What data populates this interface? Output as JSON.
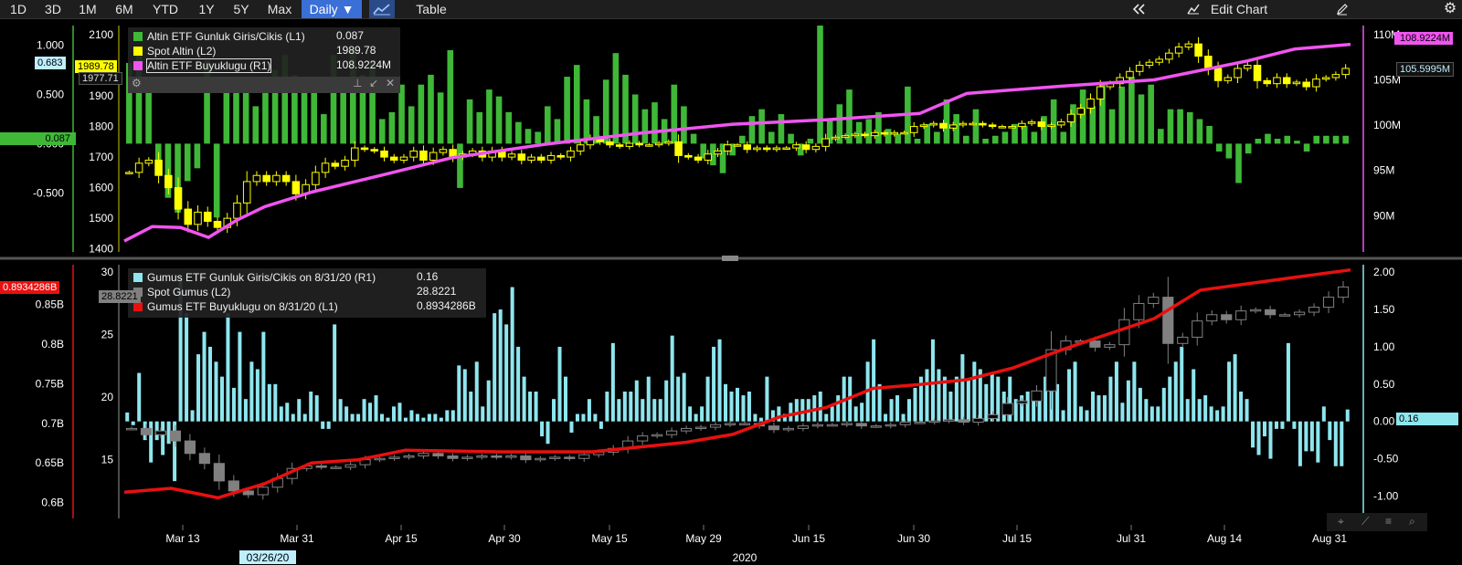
{
  "toolbar": {
    "ranges": [
      "1D",
      "3D",
      "1M",
      "6M",
      "YTD",
      "1Y",
      "5Y",
      "Max"
    ],
    "frequency": "Daily ▼",
    "table_label": "Table",
    "edit_label": "Edit Chart",
    "collapse_icon": "double-chevron-left-icon",
    "chart_icon": "line-chart-icon",
    "edit_icon": "chart-edit-icon",
    "pencil_icon": "pencil-icon",
    "gear_icon": "gear-icon"
  },
  "upper_legend": {
    "rows": [
      {
        "label": "Altin ETF Gunluk Giris/Cikis (L1)",
        "value": "0.087",
        "color": "#3fb837"
      },
      {
        "label": "Spot Altin (L2)",
        "value": "1989.78",
        "color": "#ffff00"
      },
      {
        "label": "Altin ETF Buyuklugu (R1)",
        "value": "108.9224M",
        "color": "#f055f0"
      }
    ],
    "tools": {
      "gear": "gear-icon",
      "pin": "pin-icon",
      "expand": "expand-icon",
      "close": "close-icon"
    }
  },
  "lower_legend": {
    "rows": [
      {
        "label": "Gumus ETF Gunluk Giris/Cikis on 8/31/20 (R1)",
        "value": "0.16",
        "color": "#8ee6ee"
      },
      {
        "label": "Spot Gumus (L2)",
        "value": "28.8221",
        "color": "#808080"
      },
      {
        "label": "Gumus ETF Buyuklugu on 8/31/20 (L1)",
        "value": "0.8934286B",
        "color": "#e81010"
      }
    ]
  },
  "tags": {
    "upper_L1_last": "0.087",
    "upper_L2_last": "1989.78",
    "upper_L2_prev": "1977.71",
    "upper_L1_cursor": "0.683",
    "upper_R1_last": "108.9224M",
    "upper_R1_alt": "105.5995M",
    "lower_L1_last": "0.8934286B",
    "lower_L2_last": "28.8221",
    "lower_R1_last": "0.16"
  },
  "bottom_tools": [
    "crosshair-icon",
    "draw-line-icon",
    "menu-icon",
    "zoom-icon"
  ],
  "chart_data": [
    {
      "type": "bar",
      "title": "",
      "axes": {
        "L1": {
          "ticks": [
            "1.000",
            "0.500",
            "0.000",
            "-0.500"
          ],
          "range": [
            -1.1,
            1.2
          ]
        },
        "L2": {
          "ticks": [
            "2100",
            "2000",
            "1900",
            "1800",
            "1700",
            "1600",
            "1500",
            "1400"
          ],
          "range": [
            1390,
            2130
          ]
        },
        "R1": {
          "ticks": [
            "110M",
            "105M",
            "100M",
            "95M",
            "90M"
          ],
          "range": [
            86,
            111
          ]
        }
      },
      "x_labels": [
        "Mar 13",
        "Mar 31",
        "Apr 15",
        "Apr 30",
        "May 15",
        "May 29",
        "Jun 15",
        "Jun 30",
        "Jul 15",
        "Jul 31",
        "Aug 14",
        "Aug 31"
      ],
      "series": [
        {
          "name": "Altin ETF Gunluk Giris/Cikis (L1)",
          "type": "bar",
          "axis": "L1",
          "color": "#3fb837",
          "values": [
            0.82,
            0.9,
            0.62,
            -0.2,
            -0.55,
            -0.7,
            -0.38,
            -0.25,
            0.85,
            -0.75,
            0.68,
            0.65,
            0.52,
            0.38,
            0.65,
            0.75,
            0.9,
            0.7,
            0.65,
            0.55,
            0.3,
            0.9,
            0.65,
            0.95,
            0.7,
            0.85,
            0.25,
            0.32,
            0.6,
            0.38,
            0.6,
            0.7,
            0.52,
            0.95,
            -0.45,
            0.45,
            0.32,
            0.55,
            0.48,
            0.32,
            0.22,
            0.15,
            0.12,
            0.38,
            0.25,
            0.68,
            0.8,
            0.45,
            0.28,
            0.65,
            0.92,
            0.7,
            0.5,
            0.35,
            0.42,
            0.25,
            0.6,
            0.38,
            0.1,
            -0.15,
            -0.22,
            -0.3,
            -0.12,
            0.08,
            0.28,
            0.35,
            0.12,
            0.3,
            0.1,
            -0.12,
            0.05,
            1.2,
            0.25,
            0.4,
            0.55,
            0.22,
            0.25,
            0.32,
            0.15,
            0.1,
            0.58,
            0.05,
            0.2,
            0.12,
            0.45,
            0.3,
            0.08,
            0.35,
            0.05,
            0.08,
            0.12,
            0.2,
            0.18,
            0.12,
            0.28,
            0.45,
            0.12,
            0.4,
            0.55,
            0.38,
            0.62,
            0.35,
            0.58,
            0.68,
            0.5,
            0.6,
            0.15,
            0.35,
            0.35,
            0.32,
            0.25,
            0.18,
            -0.08,
            -0.15,
            -0.4,
            -0.1,
            0.05,
            0.1,
            0.05,
            0.08,
            0.03,
            -0.08,
            0.08,
            0.08,
            0.08,
            0.08
          ]
        },
        {
          "name": "Spot Altin (L2)",
          "type": "candlestick",
          "axis": "L2",
          "color": "#ffff00",
          "closes": [
            1650,
            1680,
            1690,
            1640,
            1600,
            1530,
            1480,
            1520,
            1490,
            1470,
            1500,
            1550,
            1620,
            1640,
            1620,
            1640,
            1620,
            1580,
            1610,
            1650,
            1680,
            1670,
            1690,
            1730,
            1725,
            1720,
            1700,
            1690,
            1700,
            1720,
            1690,
            1715,
            1725,
            1700,
            1710,
            1720,
            1700,
            1720,
            1700,
            1710,
            1690,
            1700,
            1690,
            1705,
            1700,
            1720,
            1740,
            1760,
            1750,
            1740,
            1735,
            1745,
            1740,
            1740,
            1745,
            1750,
            1705,
            1700,
            1690,
            1710,
            1720,
            1740,
            1740,
            1725,
            1730,
            1725,
            1730,
            1730,
            1740,
            1725,
            1735,
            1760,
            1765,
            1770,
            1775,
            1770,
            1780,
            1775,
            1780,
            1780,
            1800,
            1805,
            1810,
            1795,
            1805,
            1810,
            1810,
            1805,
            1800,
            1800,
            1800,
            1810,
            1815,
            1800,
            1805,
            1815,
            1840,
            1860,
            1890,
            1930,
            1940,
            1960,
            1980,
            2000,
            2010,
            2020,
            2040,
            2060,
            2070,
            2030,
            1990,
            1950,
            1960,
            1990,
            2000,
            1950,
            1940,
            1960,
            1940,
            1945,
            1930,
            1955,
            1960,
            1970,
            1990
          ]
        },
        {
          "name": "Altin ETF Buyuklugu (R1)",
          "type": "line",
          "axis": "R1",
          "color": "#f055f0",
          "x_index": [
            0,
            3,
            6,
            9,
            12,
            15,
            20,
            28,
            35,
            45,
            55,
            65,
            75,
            85,
            90,
            100,
            110,
            120,
            125,
            131
          ],
          "values": [
            87.2,
            88.8,
            88.7,
            87.6,
            89.5,
            91.0,
            92.6,
            94.6,
            96.4,
            97.9,
            99.1,
            100.1,
            100.6,
            101.3,
            103.5,
            104.3,
            105.0,
            107.1,
            108.4,
            108.92
          ]
        }
      ]
    },
    {
      "type": "bar",
      "title": "",
      "axes": {
        "L1": {
          "ticks": [
            "0.85B",
            "0.8B",
            "0.75B",
            "0.7B",
            "0.65B",
            "0.6B"
          ],
          "range": [
            0.58,
            0.9
          ]
        },
        "L2": {
          "ticks": [
            "30",
            "25",
            "20",
            "15"
          ],
          "range": [
            10.3,
            30.6
          ]
        },
        "R1": {
          "ticks": [
            "2.00",
            "1.50",
            "1.00",
            "0.50",
            "0.00",
            "-0.50",
            "-1.00"
          ],
          "range": [
            -1.3,
            2.1
          ]
        }
      },
      "x_labels": [
        "Mar 13",
        "Mar 31",
        "Apr 15",
        "Apr 30",
        "May 15",
        "May 29",
        "Jun 15",
        "Jun 30",
        "Jul 15",
        "Jul 31",
        "Aug 14",
        "Aug 31"
      ],
      "x_sublabels": [
        "03/26/20",
        "2020"
      ],
      "series": [
        {
          "name": "Gumus ETF Gunluk Giris/Cikis on 8/31/20 (R1)",
          "type": "bar",
          "axis": "R1",
          "color": "#8ee6ee",
          "values": [
            0.12,
            -0.05,
            0.65,
            -0.25,
            -0.55,
            -0.25,
            -0.45,
            -0.3,
            -0.8,
            1.95,
            1.45,
            0.15,
            0.9,
            1.2,
            1.0,
            0.8,
            0.6,
            1.45,
            0.45,
            1.2,
            0.3,
            0.8,
            0.7,
            1.2,
            0.5,
            0.5,
            0.2,
            0.25,
            0.1,
            0.3,
            0.1,
            0.4,
            0.35,
            -0.1,
            -0.1,
            1.3,
            0.3,
            0.2,
            0.1,
            0.1,
            0.3,
            0.25,
            0.35,
            0.1,
            0.05,
            0.2,
            0.25,
            0.05,
            0.15,
            0.1,
            0.05,
            0.1,
            0.1,
            0.05,
            0.15,
            0.15,
            0.75,
            0.7,
            0.4,
            0.8,
            0.2,
            0.55,
            1.45,
            1.5,
            1.3,
            1.8,
            1.0,
            0.6,
            0.4,
            0.4,
            -0.2,
            -0.3,
            0.3,
            1.0,
            0.6,
            -0.15,
            0.1,
            0.1,
            0.3,
            0.1,
            -0.1,
            0.4,
            1.05,
            0.3,
            0.4,
            0.4,
            0.55,
            0.3,
            0.6,
            0.3,
            0.3,
            0.55,
            1.15,
            0.6,
            0.65,
            0.2,
            0.1,
            0.2,
            0.6,
            1.0,
            1.1,
            0.5,
            0.4,
            0.45,
            0.35,
            0.4,
            0.1,
            0.05,
            0.6,
            0.15,
            0.2,
            0.1,
            0.25,
            0.3,
            0.3,
            0.3,
            0.35,
            0.4,
            0.1,
            0.2,
            0.35,
            0.6,
            0.6,
            0.2,
            0.25,
            0.8,
            1.1,
            0.5,
            0.1,
            0.3,
            0.35,
            0.1,
            0.3,
            0.45,
            0.6,
            0.7,
            1.1,
            0.7,
            0.6,
            0.4,
            0.6,
            0.9,
            0.55,
            0.8,
            0.7,
            0.5,
            0.65,
            0.6,
            0.4,
            0.6,
            0.3,
            0.35,
            0.4,
            0.3,
            0.35,
            0.6,
            0.45,
            0.5,
            0.15,
            0.7,
            0.8,
            0.2,
            0.15,
            0.4,
            0.35,
            0.35,
            0.6,
            0.8,
            0.25,
            0.55,
            0.8,
            0.45,
            0.3,
            0.2,
            0.2,
            0.45,
            0.6,
            0.8,
            1.0,
            0.3,
            0.7,
            0.3,
            0.35,
            0.2,
            0.15,
            0.2,
            0.8,
            0.9,
            0.4,
            0.3,
            -0.35,
            -0.45,
            -0.2,
            -0.5,
            -0.1,
            -0.1,
            1.05,
            -0.1,
            -0.6,
            -0.4,
            -0.4,
            -0.55,
            0.2,
            -0.25,
            -0.6,
            -0.6,
            0.16
          ]
        },
        {
          "name": "Spot Gumus (L2)",
          "type": "candlestick",
          "axis": "L2",
          "color": "#808080",
          "closes": [
            17.5,
            17.0,
            17.3,
            16.5,
            15.5,
            14.7,
            13.3,
            12.5,
            12.2,
            12.8,
            13.5,
            14.3,
            14.5,
            14.4,
            14.4,
            14.6,
            15.0,
            15.1,
            15.2,
            15.3,
            15.5,
            15.3,
            15.1,
            15.2,
            15.3,
            15.2,
            15.3,
            15.0,
            15.1,
            15.2,
            15.1,
            15.4,
            15.6,
            15.9,
            16.5,
            16.9,
            17.0,
            17.3,
            17.5,
            17.6,
            17.8,
            17.9,
            17.9,
            17.7,
            17.4,
            17.5,
            17.7,
            17.8,
            17.8,
            17.9,
            17.7,
            17.7,
            17.8,
            18.0,
            18.0,
            18.1,
            18.2,
            18.0,
            18.3,
            18.6,
            19.5,
            19.7,
            20.5,
            23.8,
            24.5,
            24.5,
            24.0,
            24.2,
            26.2,
            27.5,
            28.0,
            24.3,
            24.8,
            26.1,
            26.6,
            26.2,
            26.9,
            27.0,
            26.6,
            26.6,
            26.8,
            27.2,
            28.0,
            28.82
          ]
        },
        {
          "name": "Gumus ETF Buyuklugu on 8/31/20 (L1)",
          "type": "line",
          "axis": "L1",
          "color": "#e81010",
          "x_index": [
            0,
            5,
            10,
            15,
            20,
            25,
            30,
            40,
            50,
            60,
            65,
            70,
            75,
            80,
            85,
            90,
            95,
            100,
            105,
            110,
            115,
            120,
            125,
            131
          ],
          "values": [
            0.613,
            0.618,
            0.606,
            0.624,
            0.65,
            0.654,
            0.666,
            0.664,
            0.664,
            0.676,
            0.686,
            0.708,
            0.72,
            0.744,
            0.749,
            0.755,
            0.77,
            0.792,
            0.812,
            0.832,
            0.868,
            0.876,
            0.884,
            0.8934
          ]
        }
      ]
    }
  ]
}
